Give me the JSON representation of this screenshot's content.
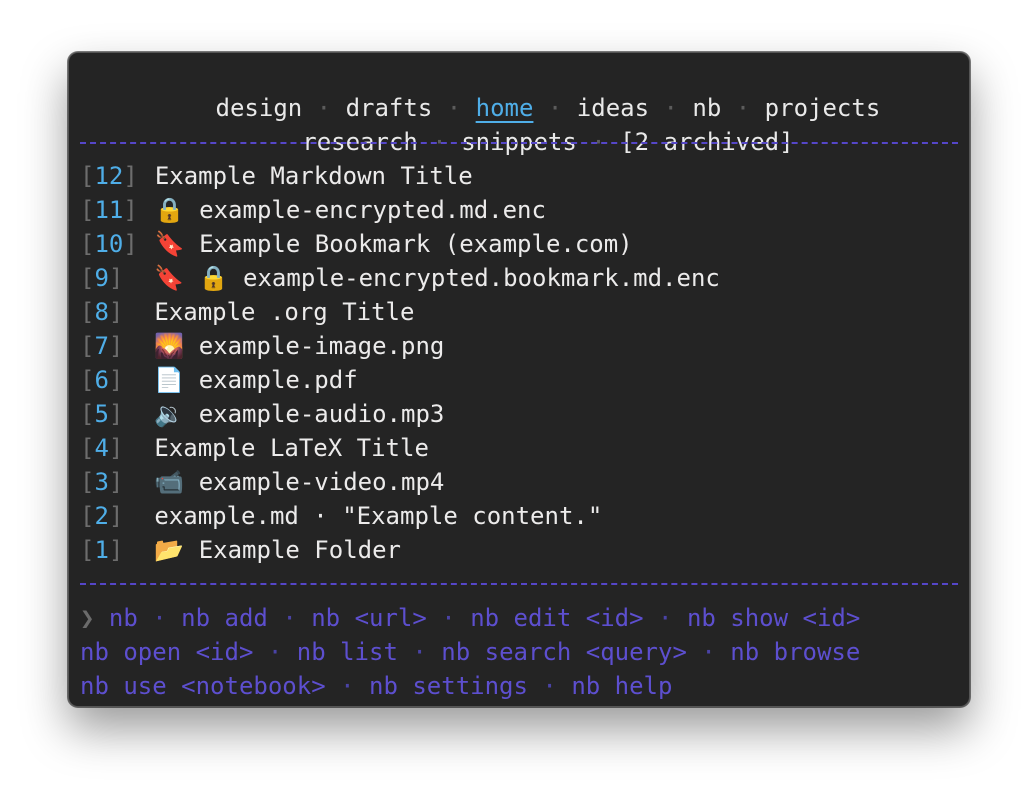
{
  "notebooks": {
    "items": [
      {
        "label": "design",
        "active": false
      },
      {
        "label": "drafts",
        "active": false
      },
      {
        "label": "home",
        "active": true
      },
      {
        "label": "ideas",
        "active": false
      },
      {
        "label": "nb",
        "active": false
      },
      {
        "label": "projects",
        "active": false
      },
      {
        "label": "research",
        "active": false
      },
      {
        "label": "snippets",
        "active": false
      }
    ],
    "archived": "[2 archived]",
    "separator": "·"
  },
  "items": [
    {
      "id": "12",
      "icon": "",
      "icon_name": "",
      "title": "Example Markdown Title"
    },
    {
      "id": "11",
      "icon": "🔒",
      "icon_name": "lock-icon",
      "title": "example-encrypted.md.enc"
    },
    {
      "id": "10",
      "icon": "🔖",
      "icon_name": "bookmark-icon",
      "title": "Example Bookmark (example.com)"
    },
    {
      "id": "9",
      "icon": "🔖 🔒",
      "icon_name": "bookmark-lock-icon",
      "title": "example-encrypted.bookmark.md.enc"
    },
    {
      "id": "8",
      "icon": "",
      "icon_name": "",
      "title": "Example .org Title"
    },
    {
      "id": "7",
      "icon": "🌄",
      "icon_name": "image-icon",
      "title": "example-image.png"
    },
    {
      "id": "6",
      "icon": "📄",
      "icon_name": "document-icon",
      "title": "example.pdf"
    },
    {
      "id": "5",
      "icon": "🔉",
      "icon_name": "speaker-icon",
      "title": "example-audio.mp3"
    },
    {
      "id": "4",
      "icon": "",
      "icon_name": "",
      "title": "Example LaTeX Title"
    },
    {
      "id": "3",
      "icon": "📹",
      "icon_name": "video-camera-icon",
      "title": "example-video.mp4"
    },
    {
      "id": "2",
      "icon": "",
      "icon_name": "",
      "title": "example.md · \"Example content.\""
    },
    {
      "id": "1",
      "icon": "📂",
      "icon_name": "folder-icon",
      "title": "Example Folder"
    }
  ],
  "help": {
    "prompt": "❯",
    "lines": [
      [
        "nb",
        "nb add",
        "nb <url>",
        "nb edit <id>",
        "nb show <id>"
      ],
      [
        "nb open <id>",
        "nb list",
        "nb search <query>",
        "nb browse"
      ],
      [
        "nb use <notebook>",
        "nb settings",
        "nb help"
      ]
    ]
  },
  "colors": {
    "background": "#242424",
    "accent": "#4faee8",
    "rule": "#5546c8",
    "help": "#5d4fcf"
  }
}
